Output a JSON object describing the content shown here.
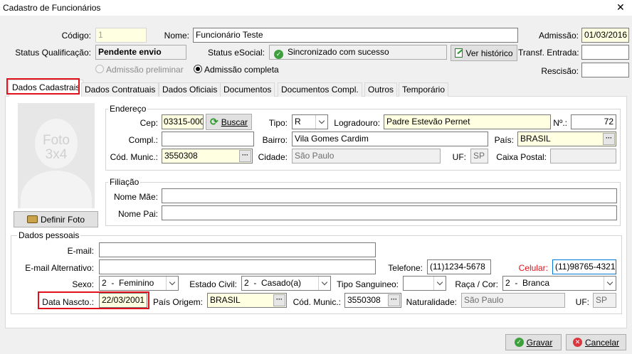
{
  "window": {
    "title": "Cadastro de Funcionários",
    "close": "✕"
  },
  "header": {
    "codigo_label": "Código:",
    "codigo_value": "1",
    "nome_label": "Nome:",
    "nome_value": "Funcionário Teste",
    "admissao_label": "Admissão:",
    "admissao_value": "01/03/2016",
    "status_qual_label": "Status Qualificação:",
    "status_qual_value": "Pendente envio",
    "status_esocial_label": "Status eSocial:",
    "status_esocial_value": "Sincronizado com sucesso",
    "ver_historico": "Ver histórico",
    "transf_label": "Transf. Entrada:",
    "rescisao_label": "Rescisão:",
    "radio_preliminar": "Admissão preliminar",
    "radio_completa": "Admissão completa"
  },
  "tabs": [
    "Dados Cadastrais",
    "Dados Contratuais",
    "Dados Oficiais",
    "Documentos",
    "Documentos Compl.",
    "Outros",
    "Temporário"
  ],
  "photo": {
    "text1": "Foto",
    "text2": "3x4",
    "button": "Definir Foto"
  },
  "endereco": {
    "title": "Endereço",
    "cep_label": "Cep:",
    "cep_value": "03315-000",
    "buscar": "Buscar",
    "tipo_label": "Tipo:",
    "tipo_value": "R",
    "logradouro_label": "Logradouro:",
    "logradouro_value": "Padre Estevão Pernet",
    "numero_label": "Nº.:",
    "numero_value": "72",
    "compl_label": "Compl.:",
    "bairro_label": "Bairro:",
    "bairro_value": "Vila Gomes Cardim",
    "pais_label": "País:",
    "pais_value": "BRASIL",
    "cod_munic_label": "Cód. Munic.:",
    "cod_munic_value": "3550308",
    "cidade_label": "Cidade:",
    "cidade_value": "São Paulo",
    "uf_label": "UF:",
    "uf_value": "SP",
    "caixa_postal_label": "Caixa Postal:"
  },
  "filiacao": {
    "title": "Filiação",
    "mae_label": "Nome Mãe:",
    "pai_label": "Nome Pai:"
  },
  "pessoais": {
    "title": "Dados pessoais",
    "email_label": "E-mail:",
    "email_alt_label": "E-mail Alternativo:",
    "telefone_label": "Telefone:",
    "telefone_value": "(11)1234-5678",
    "celular_label": "Celular:",
    "celular_value": "(11)98765-4321",
    "sexo_label": "Sexo:",
    "sexo_value": "2  -  Feminino",
    "estado_civil_label": "Estado Civil:",
    "estado_civil_value": "2  -  Casado(a)",
    "tipo_sang_label": "Tipo Sanguineo:",
    "raca_label": "Raça / Cor:",
    "raca_value": "2  -  Branca",
    "nascto_label": "Data Nascto.:",
    "nascto_value": "22/03/2001",
    "pais_origem_label": "País Origem:",
    "pais_origem_value": "BRASIL",
    "cod_munic_label": "Cód. Munic.:",
    "cod_munic_value": "3550308",
    "naturalidade_label": "Naturalidade:",
    "naturalidade_value": "São Paulo",
    "uf_label": "UF:",
    "uf_value": "SP"
  },
  "footer": {
    "gravar": "Gravar",
    "cancelar": "Cancelar"
  },
  "colors": {
    "highlight": "#e0111b",
    "yellow_field": "#ffffe1",
    "celular_label": "#e0111b"
  }
}
